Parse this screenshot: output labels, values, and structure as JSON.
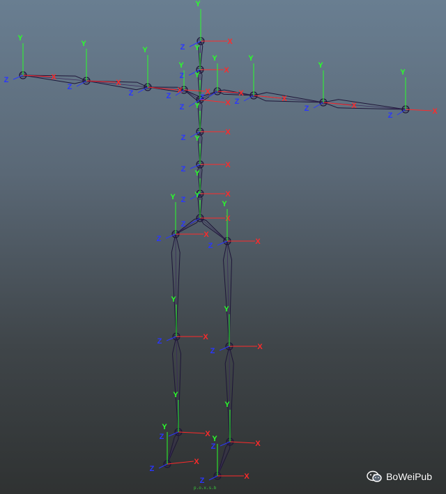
{
  "viewport": {
    "axis_labels": {
      "x": "X",
      "y": "Y",
      "z": "Z"
    },
    "colors": {
      "x_axis": "#ff2a2a",
      "y_axis": "#2aff2a",
      "z_axis": "#2a36ff",
      "bone": "#1e1538",
      "bone_fill": "#3b2a5c"
    },
    "ground_marker": "p.o.x.s.b"
  },
  "watermark": {
    "icon": "wechat-icon",
    "text": "BoWeiPub"
  }
}
